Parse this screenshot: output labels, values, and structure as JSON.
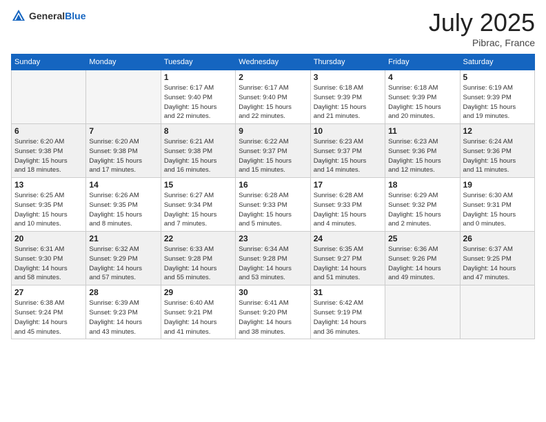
{
  "header": {
    "logo_general": "General",
    "logo_blue": "Blue",
    "month_title": "July 2025",
    "location": "Pibrac, France"
  },
  "days_of_week": [
    "Sunday",
    "Monday",
    "Tuesday",
    "Wednesday",
    "Thursday",
    "Friday",
    "Saturday"
  ],
  "weeks": [
    [
      {
        "day": "",
        "info": ""
      },
      {
        "day": "",
        "info": ""
      },
      {
        "day": "1",
        "info": "Sunrise: 6:17 AM\nSunset: 9:40 PM\nDaylight: 15 hours\nand 22 minutes."
      },
      {
        "day": "2",
        "info": "Sunrise: 6:17 AM\nSunset: 9:40 PM\nDaylight: 15 hours\nand 22 minutes."
      },
      {
        "day": "3",
        "info": "Sunrise: 6:18 AM\nSunset: 9:39 PM\nDaylight: 15 hours\nand 21 minutes."
      },
      {
        "day": "4",
        "info": "Sunrise: 6:18 AM\nSunset: 9:39 PM\nDaylight: 15 hours\nand 20 minutes."
      },
      {
        "day": "5",
        "info": "Sunrise: 6:19 AM\nSunset: 9:39 PM\nDaylight: 15 hours\nand 19 minutes."
      }
    ],
    [
      {
        "day": "6",
        "info": "Sunrise: 6:20 AM\nSunset: 9:38 PM\nDaylight: 15 hours\nand 18 minutes."
      },
      {
        "day": "7",
        "info": "Sunrise: 6:20 AM\nSunset: 9:38 PM\nDaylight: 15 hours\nand 17 minutes."
      },
      {
        "day": "8",
        "info": "Sunrise: 6:21 AM\nSunset: 9:38 PM\nDaylight: 15 hours\nand 16 minutes."
      },
      {
        "day": "9",
        "info": "Sunrise: 6:22 AM\nSunset: 9:37 PM\nDaylight: 15 hours\nand 15 minutes."
      },
      {
        "day": "10",
        "info": "Sunrise: 6:23 AM\nSunset: 9:37 PM\nDaylight: 15 hours\nand 14 minutes."
      },
      {
        "day": "11",
        "info": "Sunrise: 6:23 AM\nSunset: 9:36 PM\nDaylight: 15 hours\nand 12 minutes."
      },
      {
        "day": "12",
        "info": "Sunrise: 6:24 AM\nSunset: 9:36 PM\nDaylight: 15 hours\nand 11 minutes."
      }
    ],
    [
      {
        "day": "13",
        "info": "Sunrise: 6:25 AM\nSunset: 9:35 PM\nDaylight: 15 hours\nand 10 minutes."
      },
      {
        "day": "14",
        "info": "Sunrise: 6:26 AM\nSunset: 9:35 PM\nDaylight: 15 hours\nand 8 minutes."
      },
      {
        "day": "15",
        "info": "Sunrise: 6:27 AM\nSunset: 9:34 PM\nDaylight: 15 hours\nand 7 minutes."
      },
      {
        "day": "16",
        "info": "Sunrise: 6:28 AM\nSunset: 9:33 PM\nDaylight: 15 hours\nand 5 minutes."
      },
      {
        "day": "17",
        "info": "Sunrise: 6:28 AM\nSunset: 9:33 PM\nDaylight: 15 hours\nand 4 minutes."
      },
      {
        "day": "18",
        "info": "Sunrise: 6:29 AM\nSunset: 9:32 PM\nDaylight: 15 hours\nand 2 minutes."
      },
      {
        "day": "19",
        "info": "Sunrise: 6:30 AM\nSunset: 9:31 PM\nDaylight: 15 hours\nand 0 minutes."
      }
    ],
    [
      {
        "day": "20",
        "info": "Sunrise: 6:31 AM\nSunset: 9:30 PM\nDaylight: 14 hours\nand 58 minutes."
      },
      {
        "day": "21",
        "info": "Sunrise: 6:32 AM\nSunset: 9:29 PM\nDaylight: 14 hours\nand 57 minutes."
      },
      {
        "day": "22",
        "info": "Sunrise: 6:33 AM\nSunset: 9:28 PM\nDaylight: 14 hours\nand 55 minutes."
      },
      {
        "day": "23",
        "info": "Sunrise: 6:34 AM\nSunset: 9:28 PM\nDaylight: 14 hours\nand 53 minutes."
      },
      {
        "day": "24",
        "info": "Sunrise: 6:35 AM\nSunset: 9:27 PM\nDaylight: 14 hours\nand 51 minutes."
      },
      {
        "day": "25",
        "info": "Sunrise: 6:36 AM\nSunset: 9:26 PM\nDaylight: 14 hours\nand 49 minutes."
      },
      {
        "day": "26",
        "info": "Sunrise: 6:37 AM\nSunset: 9:25 PM\nDaylight: 14 hours\nand 47 minutes."
      }
    ],
    [
      {
        "day": "27",
        "info": "Sunrise: 6:38 AM\nSunset: 9:24 PM\nDaylight: 14 hours\nand 45 minutes."
      },
      {
        "day": "28",
        "info": "Sunrise: 6:39 AM\nSunset: 9:23 PM\nDaylight: 14 hours\nand 43 minutes."
      },
      {
        "day": "29",
        "info": "Sunrise: 6:40 AM\nSunset: 9:21 PM\nDaylight: 14 hours\nand 41 minutes."
      },
      {
        "day": "30",
        "info": "Sunrise: 6:41 AM\nSunset: 9:20 PM\nDaylight: 14 hours\nand 38 minutes."
      },
      {
        "day": "31",
        "info": "Sunrise: 6:42 AM\nSunset: 9:19 PM\nDaylight: 14 hours\nand 36 minutes."
      },
      {
        "day": "",
        "info": ""
      },
      {
        "day": "",
        "info": ""
      }
    ]
  ]
}
